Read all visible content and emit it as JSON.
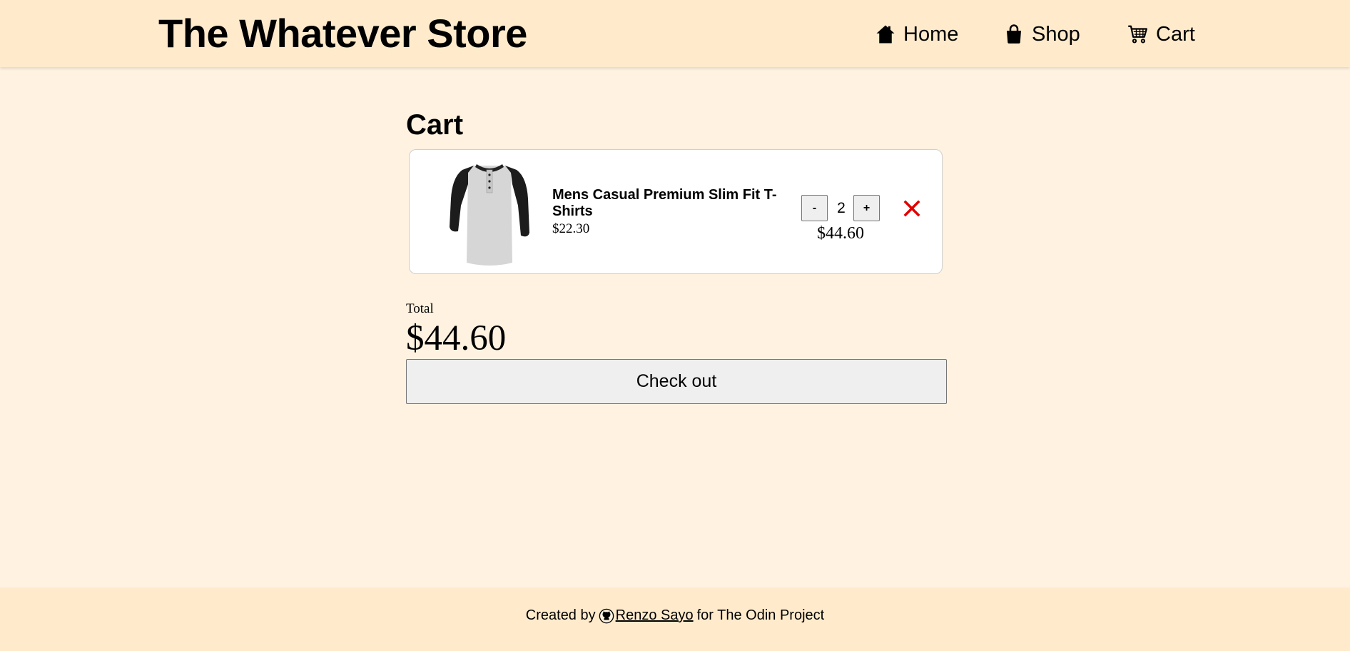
{
  "header": {
    "store_title": "The Whatever Store",
    "nav": [
      {
        "label": "Home",
        "icon": "home-icon"
      },
      {
        "label": "Shop",
        "icon": "shopping-bag-icon"
      },
      {
        "label": "Cart",
        "icon": "cart-icon"
      }
    ]
  },
  "cart": {
    "heading": "Cart",
    "items": [
      {
        "name": "Mens Casual Premium Slim Fit T-Shirts",
        "unit_price": "$22.30",
        "quantity": "2",
        "decrement_label": "-",
        "increment_label": "+",
        "subtotal": "$44.60",
        "image": "raglan-henley-shirt-image",
        "remove_icon": "close-icon"
      }
    ],
    "total_label": "Total",
    "total_value": "$44.60",
    "checkout_label": "Check out"
  },
  "footer": {
    "prefix": "Created by",
    "author": "Renzo Sayo",
    "suffix": "for The Odin Project",
    "icon": "github-icon"
  },
  "colors": {
    "background": "#fff2e0",
    "header_footer": "#ffebcc",
    "remove_red": "#e00000"
  }
}
